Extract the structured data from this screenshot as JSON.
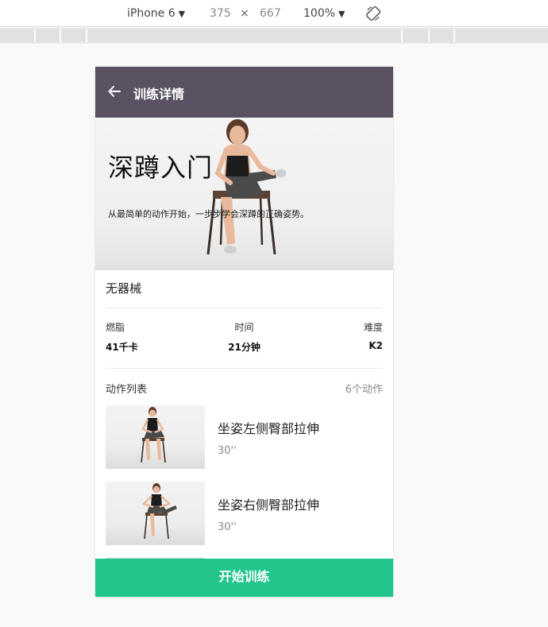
{
  "devtools": {
    "device": "iPhone 6",
    "width": "375",
    "times": "×",
    "height": "667",
    "zoom": "100%"
  },
  "header": {
    "title": "训练详情",
    "back_icon": "arrow-left-icon"
  },
  "hero": {
    "title": "深蹲入门",
    "description": "从最简单的动作开始，一步步学会深蹲的正确姿势。"
  },
  "equipment": "无器械",
  "stats": [
    {
      "label": "燃脂",
      "value": "41千卡"
    },
    {
      "label": "时间",
      "value": "21分钟"
    },
    {
      "label": "难度",
      "value": "K2"
    }
  ],
  "actions": {
    "label": "动作列表",
    "count": "6个动作",
    "items": [
      {
        "name": "坐姿左侧臀部拉伸",
        "duration": "30''"
      },
      {
        "name": "坐姿右侧臀部拉伸",
        "duration": "30''"
      }
    ]
  },
  "start_button": "开始训练",
  "colors": {
    "header_bg": "#5a5163",
    "primary": "#22c68a"
  }
}
